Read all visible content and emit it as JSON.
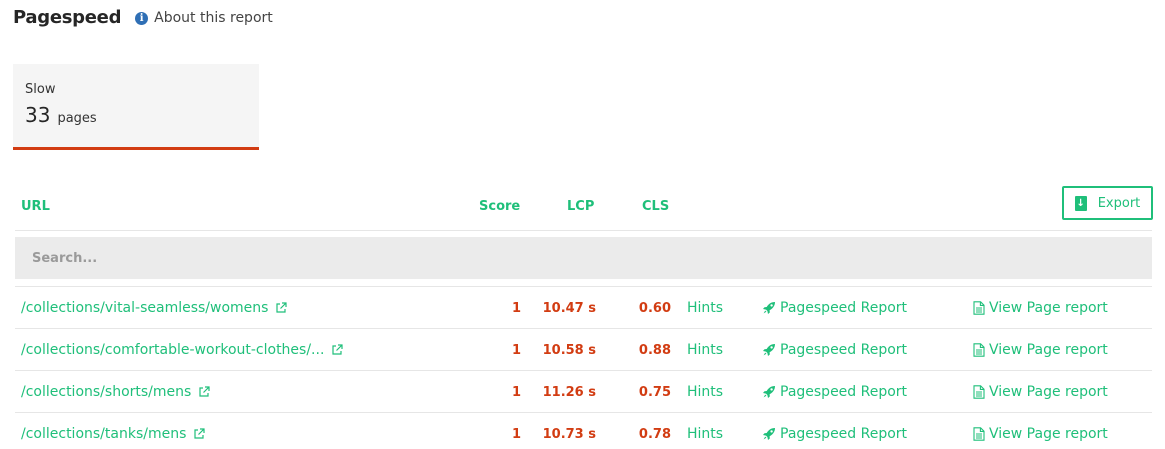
{
  "header": {
    "title": "Pagespeed",
    "about_label": "About this report"
  },
  "summary_card": {
    "label": "Slow",
    "count": "33",
    "unit": "pages",
    "accent_color": "#d23c12"
  },
  "table": {
    "columns": {
      "url": "URL",
      "score": "Score",
      "lcp": "LCP",
      "cls": "CLS"
    },
    "export_label": "Export",
    "search_placeholder": "Search...",
    "rows": [
      {
        "url": "/collections/vital-seamless/womens",
        "score": "1",
        "lcp": "10.47 s",
        "cls": "0.60",
        "hints": "Hints",
        "pagespeed": "Pagespeed Report",
        "view": "View Page report"
      },
      {
        "url": "/collections/comfortable-workout-clothes/...",
        "score": "1",
        "lcp": "10.58 s",
        "cls": "0.88",
        "hints": "Hints",
        "pagespeed": "Pagespeed Report",
        "view": "View Page report"
      },
      {
        "url": "/collections/shorts/mens",
        "score": "1",
        "lcp": "11.26 s",
        "cls": "0.75",
        "hints": "Hints",
        "pagespeed": "Pagespeed Report",
        "view": "View Page report"
      },
      {
        "url": "/collections/tanks/mens",
        "score": "1",
        "lcp": "10.73 s",
        "cls": "0.78",
        "hints": "Hints",
        "pagespeed": "Pagespeed Report",
        "view": "View Page report"
      }
    ]
  },
  "colors": {
    "accent_green": "#1fbf7a",
    "slow_red": "#d23c12",
    "info_blue": "#2f6fb5"
  },
  "icons": {
    "about": "info-icon",
    "url_link": "external-link-icon",
    "pagespeed": "rocket-icon",
    "view": "document-icon",
    "export": "download-file-icon"
  }
}
